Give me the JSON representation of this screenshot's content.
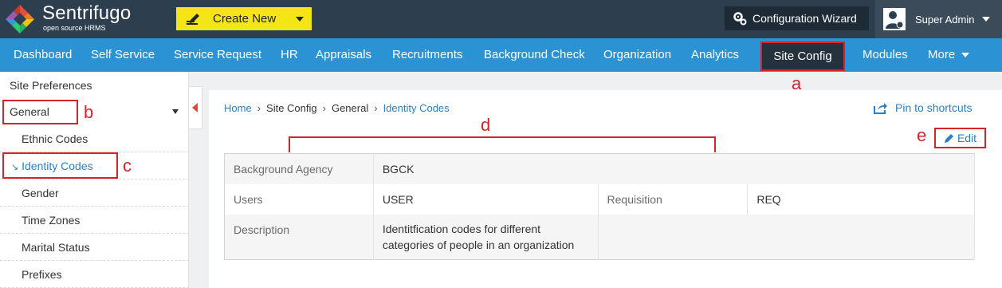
{
  "header": {
    "brand": "Sentrifugo",
    "brand_sub": "open source HRMS",
    "create_new": "Create New",
    "config_wizard": "Configuration Wizard",
    "user_name": "Super Admin",
    "colors": {
      "topbar": "#2d3e4e",
      "create_btn": "#f3e516",
      "nav": "#2b93d4",
      "accent_link": "#2b7fc2"
    }
  },
  "nav": {
    "items": [
      "Dashboard",
      "Self Service",
      "Service Request",
      "HR",
      "Appraisals",
      "Recruitments",
      "Background Check",
      "Organization",
      "Analytics",
      "Site Config",
      "Modules",
      "More"
    ],
    "active": "Site Config"
  },
  "sidebar": {
    "title": "Site Preferences",
    "group": "General",
    "items": [
      "Ethnic Codes",
      "Identity Codes",
      "Gender",
      "Time Zones",
      "Marital Status",
      "Prefixes"
    ],
    "active": "Identity Codes"
  },
  "breadcrumb": [
    "Home",
    "Site Config",
    "General",
    "Identity Codes"
  ],
  "pin_to_shortcuts": "Pin to shortcuts",
  "edit_label": "Edit",
  "details": {
    "background_agency_label": "Background Agency",
    "background_agency_value": "BGCK",
    "users_label": "Users",
    "users_value": "USER",
    "requisition_label": "Requisition",
    "requisition_value": "REQ",
    "description_label": "Description",
    "description_value": "Identitfication codes for different categories of people in an organization"
  },
  "annotations": {
    "a": "a",
    "b": "b",
    "c": "c",
    "d": "d",
    "e": "e"
  }
}
